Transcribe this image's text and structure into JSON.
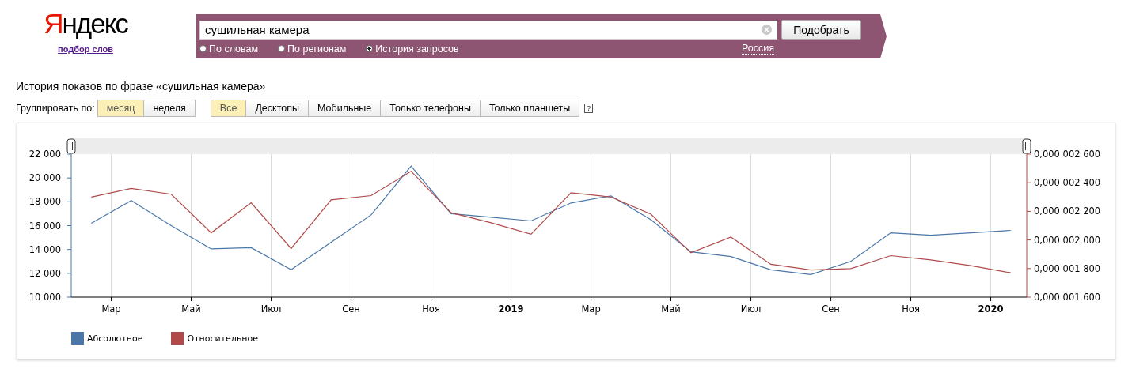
{
  "logo": "Яндекс",
  "logo_subtitle": "подбор слов",
  "search": {
    "value": "сушильная камера",
    "button": "Подобрать",
    "modes": [
      {
        "label": "По словам",
        "selected": false
      },
      {
        "label": "По регионам",
        "selected": false
      },
      {
        "label": "История запросов",
        "selected": true
      }
    ],
    "region": "Россия"
  },
  "heading": "История показов по фразе «сушильная камера»",
  "group_label": "Группировать по:",
  "group_by": [
    {
      "label": "месяц",
      "selected": true
    },
    {
      "label": "неделя",
      "selected": false
    }
  ],
  "devices": [
    {
      "label": "Все",
      "selected": true
    },
    {
      "label": "Десктопы",
      "selected": false
    },
    {
      "label": "Мобильные",
      "selected": false
    },
    {
      "label": "Только телефоны",
      "selected": false
    },
    {
      "label": "Только планшеты",
      "selected": false
    }
  ],
  "help": "?",
  "chart_data": {
    "type": "line",
    "grid": true,
    "x": [
      2018.125,
      2018.2083,
      2018.2917,
      2018.375,
      2018.4583,
      2018.5417,
      2018.625,
      2018.7083,
      2018.7917,
      2018.875,
      2018.9583,
      2019.0417,
      2019.125,
      2019.2083,
      2019.2917,
      2019.375,
      2019.4583,
      2019.5417,
      2019.625,
      2019.7083,
      2019.7917,
      2019.875,
      2019.9583,
      2020.0417
    ],
    "xlim": [
      2018.0833,
      2020.075
    ],
    "xticks": [
      {
        "value": 2018.1667,
        "label": "Мар"
      },
      {
        "value": 2018.3333,
        "label": "Май"
      },
      {
        "value": 2018.5,
        "label": "Июл"
      },
      {
        "value": 2018.6667,
        "label": "Сен"
      },
      {
        "value": 2018.8333,
        "label": "Ноя"
      },
      {
        "value": 2019,
        "label": "2019"
      },
      {
        "value": 2019.1667,
        "label": "Мар"
      },
      {
        "value": 2019.3333,
        "label": "Май"
      },
      {
        "value": 2019.5,
        "label": "Июл"
      },
      {
        "value": 2019.6667,
        "label": "Сен"
      },
      {
        "value": 2019.8333,
        "label": "Ноя"
      },
      {
        "value": 2020,
        "label": "2020"
      }
    ],
    "ylim": [
      10000,
      22000
    ],
    "yticks": [
      {
        "value": 10000,
        "label": "10 000"
      },
      {
        "value": 12000,
        "label": "12 000"
      },
      {
        "value": 14000,
        "label": "14 000"
      },
      {
        "value": 16000,
        "label": "16 000"
      },
      {
        "value": 18000,
        "label": "18 000"
      },
      {
        "value": 20000,
        "label": "20 000"
      },
      {
        "value": 22000,
        "label": "22 000"
      }
    ],
    "y2lim": [
      1.6e-06,
      2.6e-06
    ],
    "y2ticks": [
      {
        "value": 1.6e-06,
        "label": "0,000 001 600"
      },
      {
        "value": 1.8e-06,
        "label": "0,000 001 800"
      },
      {
        "value": 2e-06,
        "label": "0,000 002 000"
      },
      {
        "value": 2.2e-06,
        "label": "0,000 002 200"
      },
      {
        "value": 2.4e-06,
        "label": "0,000 002 400"
      },
      {
        "value": 2.6e-06,
        "label": "0,000 002 600"
      }
    ],
    "series": [
      {
        "name": "Абсолютное",
        "color": "#4a76a8",
        "values": [
          16200,
          18100,
          16000,
          14050,
          14150,
          12300,
          14600,
          16900,
          21000,
          17000,
          16700,
          16400,
          17900,
          18500,
          16500,
          13800,
          13400,
          12300,
          11900,
          13000,
          15400,
          15200,
          15400,
          15600
        ]
      },
      {
        "name": "Относительное",
        "color": "#b04a4a",
        "axis": "y2",
        "values": [
          2.3e-06,
          2.36e-06,
          2.32e-06,
          2.05e-06,
          2.26e-06,
          1.94e-06,
          2.28e-06,
          2.31e-06,
          2.48e-06,
          2.19e-06,
          2.12e-06,
          2.04e-06,
          2.33e-06,
          2.3e-06,
          2.18e-06,
          1.91e-06,
          2.02e-06,
          1.83e-06,
          1.79e-06,
          1.8e-06,
          1.89e-06,
          1.86e-06,
          1.82e-06,
          1.77e-06
        ]
      }
    ]
  }
}
